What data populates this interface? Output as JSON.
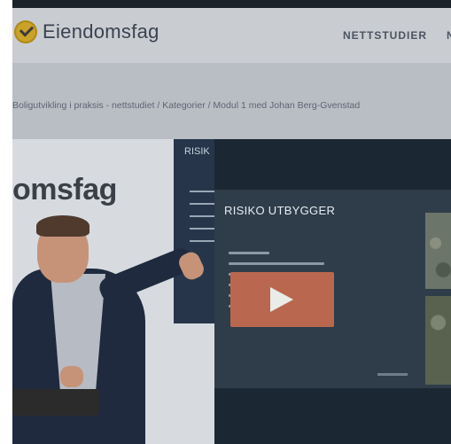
{
  "header": {
    "logo_text": "Eiendomsfag",
    "nav": [
      "NETTSTUDIER",
      "N"
    ]
  },
  "breadcrumb": "Boligutvikling i praksis - nettstudiet / Kategorier / Modul 1 med Johan Berg-Gvenstad",
  "video": {
    "room_sign": "omsfag",
    "tv_title": "RISIK",
    "slide_title": "RISIKO UTBYGGER",
    "play_color": "#b9684f"
  }
}
